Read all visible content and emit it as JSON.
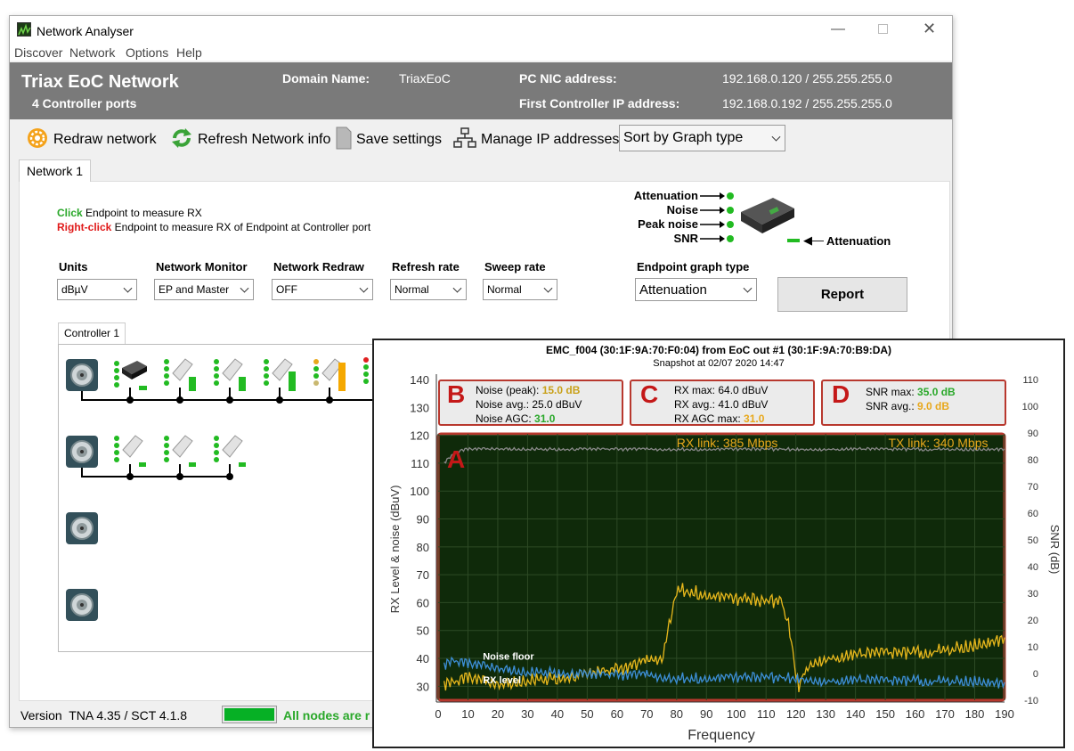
{
  "window": {
    "title": "Network Analyser",
    "menu": [
      "Discover",
      "Network",
      "Options",
      "Help"
    ]
  },
  "header": {
    "title": "Triax EoC Network",
    "subtitle": "4 Controller ports",
    "domain_label": "Domain Name:",
    "domain_value": "TriaxEoC",
    "nic_label": "PC NIC address:",
    "nic_value": "192.168.0.120 / 255.255.255.0",
    "controller_label": "First Controller IP address:",
    "controller_value": "192.168.0.192 / 255.255.255.0"
  },
  "toolbar": {
    "redraw": "Redraw network",
    "refresh": "Refresh Network info",
    "save": "Save settings",
    "manage": "Manage IP addresses",
    "sort": "Sort by Graph type"
  },
  "tabs": {
    "network": "Network 1",
    "controller": "Controller 1"
  },
  "instructions": {
    "click": "Click",
    "click_text": " Endpoint to measure RX",
    "right_click": "Right-click",
    "right_click_text": " Endpoint to measure RX of Endpoint at Controller port"
  },
  "legend": {
    "attenuation": "Attenuation",
    "noise": "Noise",
    "peak_noise": "Peak noise",
    "snr": "SNR",
    "bar_attenuation": "Attenuation"
  },
  "controls": {
    "units": {
      "label": "Units",
      "value": "dBµV"
    },
    "monitor": {
      "label": "Network Monitor",
      "value": "EP and Master"
    },
    "redraw": {
      "label": "Network Redraw",
      "value": "OFF"
    },
    "refresh": {
      "label": "Refresh rate",
      "value": "Normal"
    },
    "sweep": {
      "label": "Sweep rate",
      "value": "Normal"
    },
    "graph_type": {
      "label": "Endpoint graph type",
      "value": "Attenuation"
    },
    "report": "Report"
  },
  "status": {
    "version": "Version  TNA 4.35 / SCT 4.1.8",
    "message": "All nodes are r",
    "progress": 1.0
  },
  "graph": {
    "title": "EMC_f004 (30:1F:9A:70:F0:04) from EoC out #1 (30:1F:9A:70:B9:DA)",
    "snapshot": "Snapshot at 02/07 2020 14:47",
    "box_b": {
      "letter": "B",
      "l1": "Noise (peak): ",
      "v1": "15.0 dB",
      "l2": "Noise avg.: 25.0 dBuV",
      "l3": "Noise AGC: ",
      "v3": "31.0"
    },
    "box_c": {
      "letter": "C",
      "l1": "RX max: 64.0 dBuV",
      "l2": "RX avg.: 41.0 dBuV",
      "l3": "RX AGC max: ",
      "v3": "31.0"
    },
    "box_d": {
      "letter": "D",
      "l1": "SNR max: ",
      "v1": "35.0 dB",
      "l2": "SNR avg.: ",
      "v2": "9.0 dB"
    },
    "letter_a": "A",
    "rx_link": "RX link: 385 Mbps",
    "tx_link": "TX link: 340 Mbps",
    "noise_floor_label": "Noise floor",
    "rx_level_label": "RX level",
    "colors": {
      "plot_bg": "#0f2a0a",
      "rx": "#e8b81c",
      "noise": "#3d8fd8",
      "snr": "#888888",
      "frame": "#b8382e",
      "green": "#2aa82a"
    }
  },
  "chart_data": {
    "type": "line",
    "xlabel": "Frequency",
    "ylabel": "RX Level & noise (dBuV)",
    "y2label": "SNR (dB)",
    "xlim": [
      0,
      190
    ],
    "ylim": [
      25,
      140
    ],
    "y2lim": [
      -10,
      110
    ],
    "xticks": [
      0,
      10,
      20,
      30,
      40,
      50,
      60,
      70,
      80,
      90,
      100,
      110,
      120,
      130,
      140,
      150,
      160,
      170,
      180,
      190
    ],
    "yticks": [
      30,
      40,
      50,
      60,
      70,
      80,
      90,
      100,
      110,
      120,
      130,
      140
    ],
    "y2ticks": [
      -10,
      0,
      10,
      20,
      30,
      40,
      50,
      60,
      70,
      80,
      90,
      100,
      110
    ],
    "series": [
      {
        "name": "RX level",
        "x": [
          2,
          10,
          20,
          30,
          40,
          50,
          60,
          65,
          70,
          73,
          75,
          78,
          80,
          85,
          90,
          95,
          100,
          105,
          110,
          115,
          118,
          120,
          121,
          123,
          126,
          130,
          140,
          150,
          160,
          170,
          175,
          180,
          185,
          190
        ],
        "values": [
          30,
          33,
          30,
          32,
          33,
          34,
          36,
          37,
          39,
          40,
          40,
          55,
          65,
          64,
          63,
          62,
          61,
          61,
          60,
          61,
          50,
          35,
          30,
          36,
          39,
          40,
          41,
          42,
          42,
          43,
          44,
          45,
          46,
          47
        ]
      },
      {
        "name": "Noise floor",
        "x": [
          2,
          5,
          10,
          20,
          30,
          40,
          50,
          60,
          70,
          80,
          90,
          100,
          110,
          120,
          130,
          140,
          150,
          160,
          170,
          180,
          190
        ],
        "values": [
          37,
          39,
          38,
          36,
          35,
          35,
          34,
          34,
          34,
          33,
          33,
          33,
          33,
          33,
          32,
          32,
          32,
          32,
          32,
          32,
          31
        ]
      },
      {
        "x": [
          2,
          4,
          6,
          10,
          20,
          40,
          60,
          80,
          100,
          120,
          140,
          160,
          180,
          190
        ],
        "values": [
          110,
          112,
          114,
          115,
          115,
          115,
          115,
          115,
          115,
          115,
          115,
          115,
          115,
          115
        ]
      }
    ]
  }
}
